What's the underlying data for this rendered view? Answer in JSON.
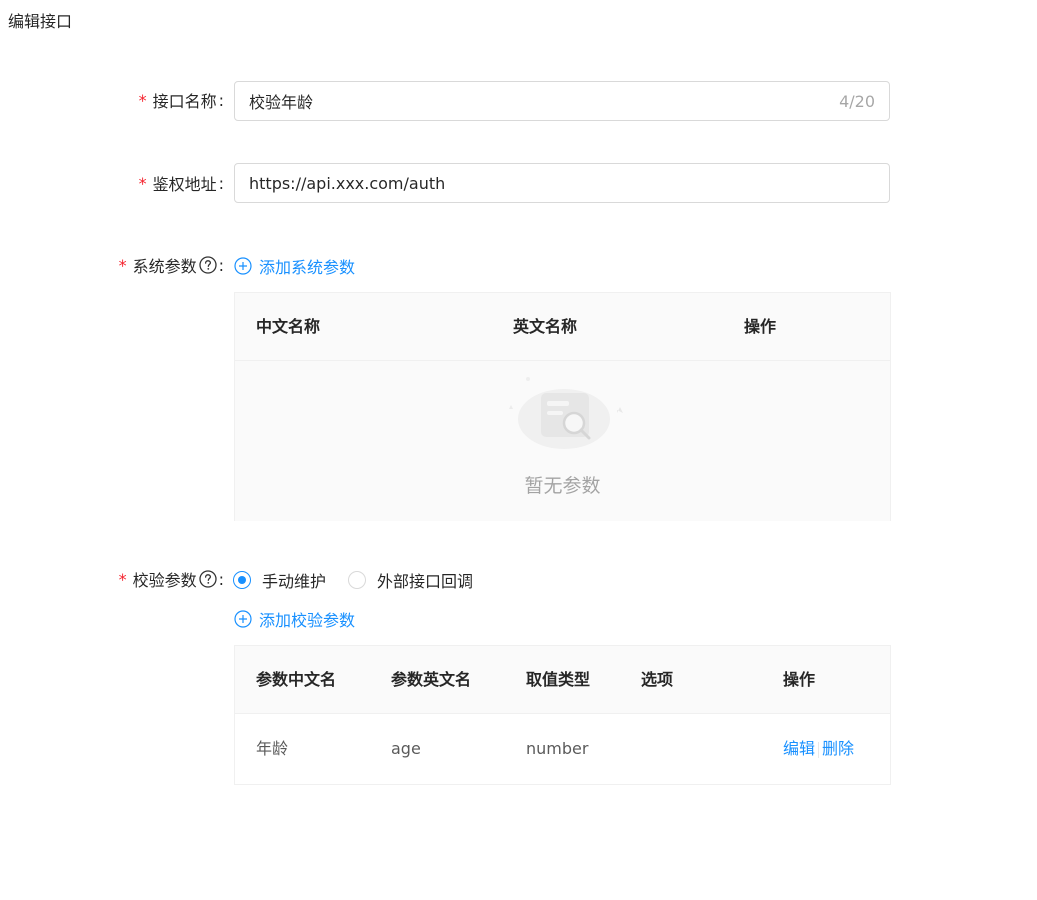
{
  "page": {
    "title": "编辑接口"
  },
  "form": {
    "name": {
      "label": "接口名称",
      "colon": ":",
      "value": "校验年龄",
      "count": "4/20",
      "required_mark": "*"
    },
    "auth": {
      "label": "鉴权地址",
      "colon": ":",
      "value": "https://api.xxx.com/auth",
      "required_mark": "*"
    },
    "system_params": {
      "label": "系统参数",
      "colon": ":",
      "required_mark": "*",
      "add_label": "添加系统参数",
      "columns": [
        "中文名称",
        "英文名称",
        "操作"
      ],
      "empty_text": "暂无参数"
    },
    "verify_params": {
      "label": "校验参数",
      "colon": ":",
      "required_mark": "*",
      "radio_options": [
        {
          "label": "手动维护",
          "checked": true
        },
        {
          "label": "外部接口回调",
          "checked": false
        }
      ],
      "add_label": "添加校验参数",
      "columns": [
        "参数中文名",
        "参数英文名",
        "取值类型",
        "选项",
        "操作"
      ],
      "rows": [
        {
          "cn_name": "年龄",
          "en_name": "age",
          "type": "number",
          "option": "",
          "edit_label": "编辑",
          "delete_label": "删除"
        }
      ]
    }
  },
  "colors": {
    "accent": "#1890ff",
    "required": "#f5222d"
  },
  "icons": {
    "help": "question-circle-icon",
    "add": "plus-circle-icon",
    "empty": "empty-search-icon"
  }
}
